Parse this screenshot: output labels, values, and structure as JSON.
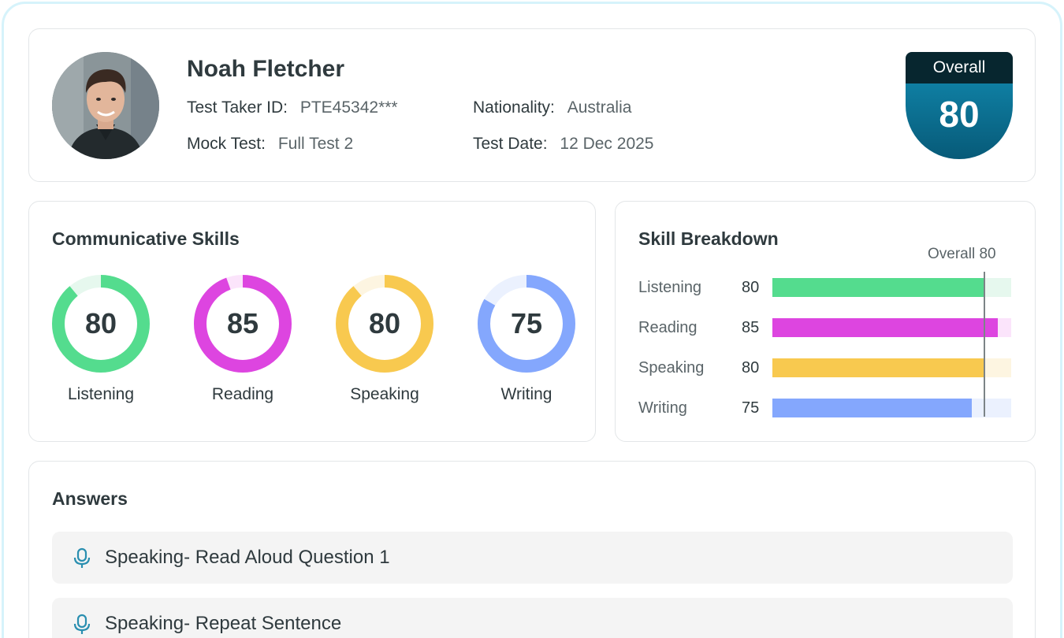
{
  "profile": {
    "name": "Noah Fletcher",
    "test_taker_id_label": "Test Taker ID:",
    "test_taker_id": "PTE45342***",
    "nationality_label": "Nationality:",
    "nationality": "Australia",
    "mock_test_label": "Mock Test:",
    "mock_test": "Full Test 2",
    "test_date_label": "Test Date:",
    "test_date": "12 Dec 2025",
    "overall_label": "Overall",
    "overall_score": "80"
  },
  "skills": {
    "title": "Communicative Skills",
    "max_score": 90,
    "items": [
      {
        "label": "Listening",
        "score": 80,
        "color": "#54dc8e",
        "track": "#e6f8ee"
      },
      {
        "label": "Reading",
        "score": 85,
        "color": "#dd45e0",
        "track": "#fbe4fb"
      },
      {
        "label": "Speaking",
        "score": 80,
        "color": "#f8c94f",
        "track": "#fdf5e1"
      },
      {
        "label": "Writing",
        "score": 75,
        "color": "#84a7fd",
        "track": "#ebf1fe"
      }
    ]
  },
  "breakdown": {
    "title": "Skill Breakdown",
    "overall_marker_label": "Overall 80",
    "overall_value": 80,
    "max_score": 90,
    "rows": [
      {
        "label": "Listening",
        "score": 80,
        "color": "#54dc8e",
        "track": "#e6f8ee"
      },
      {
        "label": "Reading",
        "score": 85,
        "color": "#dd45e0",
        "track": "#fbe4fb"
      },
      {
        "label": "Speaking",
        "score": 80,
        "color": "#f8c94f",
        "track": "#fdf5e1"
      },
      {
        "label": "Writing",
        "score": 75,
        "color": "#84a7fd",
        "track": "#ebf1fe"
      }
    ]
  },
  "answers": {
    "title": "Answers",
    "items": [
      {
        "label": "Speaking- Read Aloud Question 1",
        "icon": "microphone-icon"
      },
      {
        "label": "Speaking- Repeat Sentence",
        "icon": "microphone-icon"
      }
    ]
  }
}
